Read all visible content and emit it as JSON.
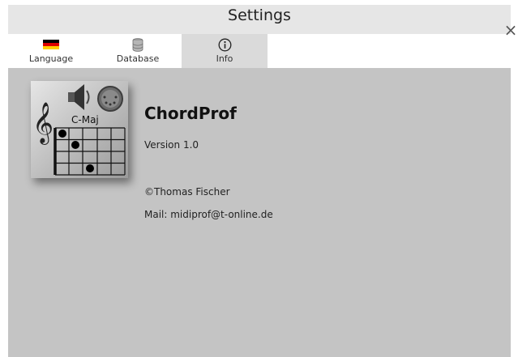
{
  "window": {
    "title": "Settings"
  },
  "tabs": [
    {
      "label": "Language",
      "icon": "german-flag-icon"
    },
    {
      "label": "Database",
      "icon": "database-icon"
    },
    {
      "label": "Info",
      "icon": "info-icon",
      "active": true
    }
  ],
  "info": {
    "app_name": "ChordProf",
    "version": "Version 1.0",
    "copyright": "©Thomas Fischer",
    "mail": "Mail: midiprof@t-online.de",
    "icon_chord_label": "C-Maj"
  },
  "colors": {
    "panel_bg": "#c4c4c4",
    "titlebar_bg": "#e6e6e6",
    "active_tab_bg": "#dadada"
  }
}
